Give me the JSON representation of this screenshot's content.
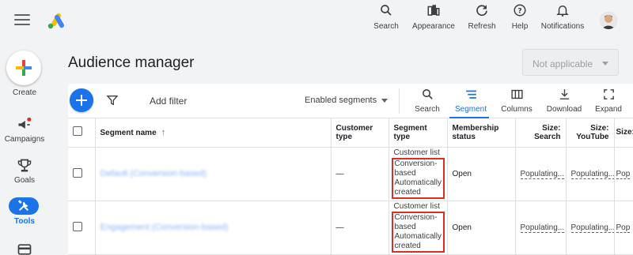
{
  "top_actions": [
    {
      "label": "Search",
      "icon": "search-icon"
    },
    {
      "label": "Appearance",
      "icon": "appearance-icon"
    },
    {
      "label": "Refresh",
      "icon": "refresh-icon"
    },
    {
      "label": "Help",
      "icon": "help-icon"
    },
    {
      "label": "Notifications",
      "icon": "bell-icon"
    }
  ],
  "rail": {
    "create_label": "Create",
    "items": [
      {
        "label": "Campaigns",
        "icon": "megaphone-icon",
        "has_badge": true
      },
      {
        "label": "Goals",
        "icon": "trophy-icon"
      },
      {
        "label": "Tools",
        "icon": "tools-icon",
        "active": true
      }
    ]
  },
  "page": {
    "title": "Audience manager",
    "scope_select": "Not applicable"
  },
  "toolbar": {
    "add_filter": "Add filter",
    "enabled_segments": "Enabled segments",
    "buttons": [
      {
        "label": "Search",
        "icon": "search-icon"
      },
      {
        "label": "Segment",
        "icon": "segment-icon",
        "active": true
      },
      {
        "label": "Columns",
        "icon": "columns-icon"
      },
      {
        "label": "Download",
        "icon": "download-icon"
      },
      {
        "label": "Expand",
        "icon": "expand-icon"
      }
    ]
  },
  "table": {
    "headers": {
      "segment_name": "Segment name",
      "customer_type": "Customer type",
      "segment_type": "Segment type",
      "membership_status": "Membership status",
      "size_search_1": "Size:",
      "size_search_2": "Search",
      "size_youtube_1": "Size:",
      "size_youtube_2": "YouTube",
      "size_more": "Size:"
    },
    "rows": [
      {
        "name": "Default (Conversion-based)",
        "customer_type": "—",
        "segment_type_line1": "Customer list",
        "segment_type_boxed1": "Conversion-",
        "segment_type_boxed2": "based",
        "segment_type_boxed3": "Automatically",
        "segment_type_boxed4": "created",
        "membership_status": "Open",
        "size_search": "Populating...",
        "size_youtube": "Populating...",
        "size_more": "Pop"
      },
      {
        "name": "Engagement (Conversion-based)",
        "customer_type": "—",
        "segment_type_line1": "Customer list",
        "segment_type_boxed1": "Conversion-",
        "segment_type_boxed2": "based",
        "segment_type_boxed3": "Automatically",
        "segment_type_boxed4": "created",
        "membership_status": "Open",
        "size_search": "Populating...",
        "size_youtube": "Populating...",
        "size_more": "Pop"
      }
    ]
  }
}
